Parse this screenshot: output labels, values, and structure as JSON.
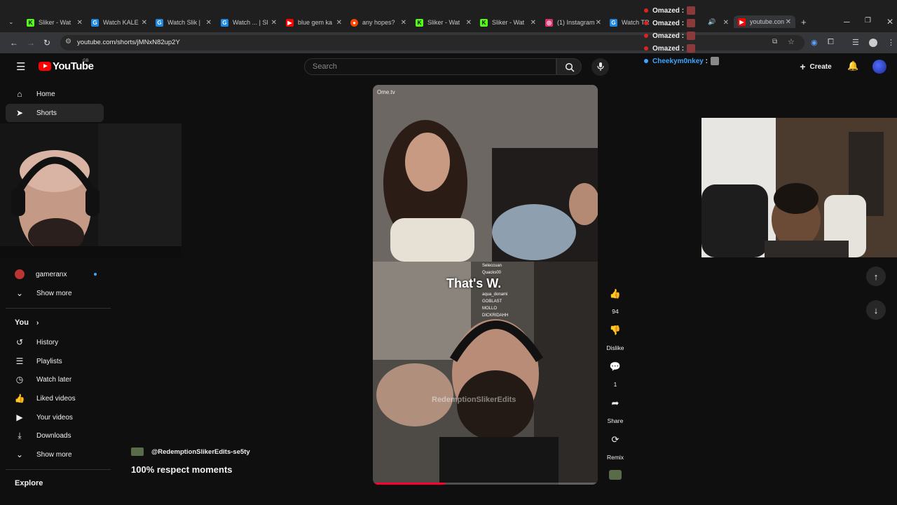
{
  "browser": {
    "tabs": [
      {
        "label": "Sliker - Wat",
        "icon": "kick-icon",
        "color": "#53fc18"
      },
      {
        "label": "Watch KALE",
        "icon": "generic-site-icon",
        "color": "#1e88e5"
      },
      {
        "label": "Watch Slik |",
        "icon": "generic-site-icon",
        "color": "#1e88e5"
      },
      {
        "label": "Watch ... | Sl",
        "icon": "generic-site-icon",
        "color": "#1e88e5"
      },
      {
        "label": "blue gem ka",
        "icon": "youtube-icon",
        "color": "#ff0000"
      },
      {
        "label": "any hopes?",
        "icon": "reddit-icon",
        "color": "#ff4500"
      },
      {
        "label": "Sliker - Wat",
        "icon": "kick-icon",
        "color": "#53fc18"
      },
      {
        "label": "Sliker - Wat",
        "icon": "kick-icon",
        "color": "#53fc18"
      },
      {
        "label": "(1) Instagram",
        "icon": "instagram-icon",
        "color": "#e1306c"
      },
      {
        "label": "Watch TR",
        "icon": "generic-site-icon",
        "color": "#1e88e5"
      },
      {
        "label": "youtube.con",
        "icon": "youtube-icon",
        "color": "#ff0000"
      }
    ],
    "new_tab": "+",
    "url": "youtube.com/shorts/jMNxN82up2Y"
  },
  "header": {
    "logo": "YouTube",
    "region": "GB",
    "search_placeholder": "Search",
    "create_label": "Create"
  },
  "sidebar": {
    "main": [
      {
        "label": "Home",
        "icon": "home-icon"
      },
      {
        "label": "Shorts",
        "icon": "shorts-icon"
      }
    ],
    "subscriptions": [
      {
        "label": "gameranx"
      }
    ],
    "show_more": "Show more",
    "you_heading": "You",
    "you_items": [
      {
        "label": "History",
        "icon": "history-icon"
      },
      {
        "label": "Playlists",
        "icon": "playlists-icon"
      },
      {
        "label": "Watch later",
        "icon": "watch-later-icon"
      },
      {
        "label": "Liked videos",
        "icon": "like-icon"
      },
      {
        "label": "Your videos",
        "icon": "your-videos-icon"
      },
      {
        "label": "Downloads",
        "icon": "download-icon"
      }
    ],
    "show_more_2": "Show more",
    "explore_heading": "Explore"
  },
  "short": {
    "overlay_text": "That's W.",
    "watermark": "RedemptionSlikerEdits",
    "ometv": "Ome.tv",
    "channel": "@RedemptionSlikerEdits-se5ty",
    "title": "100% respect moments",
    "progress": 0.32,
    "stream_chat": [
      "Seleccuan",
      "Quacks00",
      "aqua_donami",
      "GOBLAST",
      "MOLLO",
      "DICKRIDAHH"
    ]
  },
  "actions": {
    "like_count": "94",
    "dislike_label": "Dislike",
    "comment_count": "1",
    "share_label": "Share",
    "remix_label": "Remix"
  },
  "chat_overlay": [
    {
      "user": "Omazed",
      "sep": ":"
    },
    {
      "user": "Omazed",
      "sep": ":"
    },
    {
      "user": "Omazed",
      "sep": ":"
    },
    {
      "user": "Omazed",
      "sep": ":"
    },
    {
      "user": "Cheekym0nkey",
      "sep": ":"
    }
  ]
}
